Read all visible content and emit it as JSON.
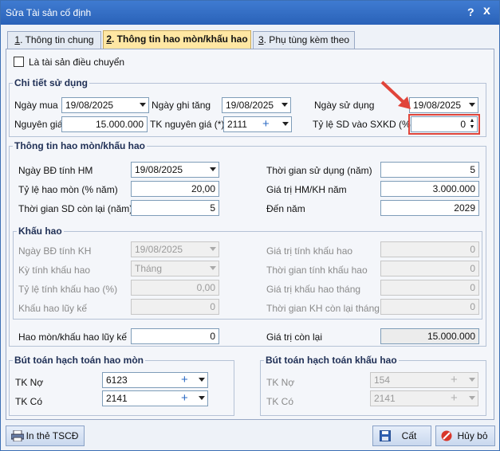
{
  "window": {
    "title": "Sửa Tài sản cố định",
    "help": "?",
    "close": "x"
  },
  "tabs": [
    {
      "num": "1",
      "label": ". Thông tin chung"
    },
    {
      "num": "2",
      "label": ". Thông tin hao mòn/khấu hao"
    },
    {
      "num": "3",
      "label": ". Phụ tùng kèm theo"
    }
  ],
  "transfer_label": "Là tài sản điều chuyển",
  "usage": {
    "title": "Chi tiết sử dụng",
    "buy_date_label": "Ngày mua",
    "buy_date": "19/08/2025",
    "increase_date_label": "Ngày ghi tăng",
    "increase_date": "19/08/2025",
    "use_date_label": "Ngày sử dụng",
    "use_date": "19/08/2025",
    "cost_label": "Nguyên giá",
    "cost": "15.000.000",
    "cost_account_label": "TK nguyên giá (*)",
    "cost_account": "2111",
    "ratio_label": "Tỷ lệ SD vào SXKD (%)",
    "ratio": "0"
  },
  "depreciation": {
    "title": "Thông tin hao mòn/khấu hao",
    "start_label": "Ngày BĐ tính HM",
    "start": "19/08/2025",
    "life_label": "Thời gian sử dụng (năm)",
    "life": "5",
    "rate_label": "Tỷ lệ hao mòn (% năm)",
    "rate": "20,00",
    "annual_label": "Giá trị HM/KH năm",
    "annual": "3.000.000",
    "remain_label": "Thời gian SD còn lại (năm)",
    "remain": "5",
    "to_year_label": "Đến năm",
    "to_year": "2029"
  },
  "khauhao": {
    "title": "Khấu hao",
    "start_label": "Ngày BĐ tính KH",
    "start": "19/08/2025",
    "value_label": "Giá trị tính khấu hao",
    "value": "0",
    "period_label": "Kỳ tính khấu hao",
    "period": "Tháng",
    "time_label": "Thời gian tính khấu hao",
    "time": "0",
    "rate_label": "Tỷ lệ tính khấu hao (%)",
    "rate": "0,00",
    "monthly_label": "Giá trị khấu hao tháng",
    "monthly": "0",
    "accum_label": "Khấu hao lũy kế",
    "accum": "0",
    "remain_label": "Thời gian KH còn lại tháng",
    "remain": "0"
  },
  "totals": {
    "accum_label": "Hao mòn/khấu hao lũy kế",
    "accum": "0",
    "residual_label": "Giá trị còn lại",
    "residual": "15.000.000"
  },
  "entries_hm": {
    "title": "Bút toán hạch toán hao mòn",
    "debit_label": "TK Nợ",
    "debit": "6123",
    "credit_label": "TK Có",
    "credit": "2141"
  },
  "entries_kh": {
    "title": "Bút toán hạch toán khấu hao",
    "debit_label": "TK Nợ",
    "debit": "154",
    "credit_label": "TK Có",
    "credit": "2141"
  },
  "buttons": {
    "print": "In thẻ TSCĐ",
    "save": "Cất",
    "cancel": "Hủy bỏ"
  }
}
